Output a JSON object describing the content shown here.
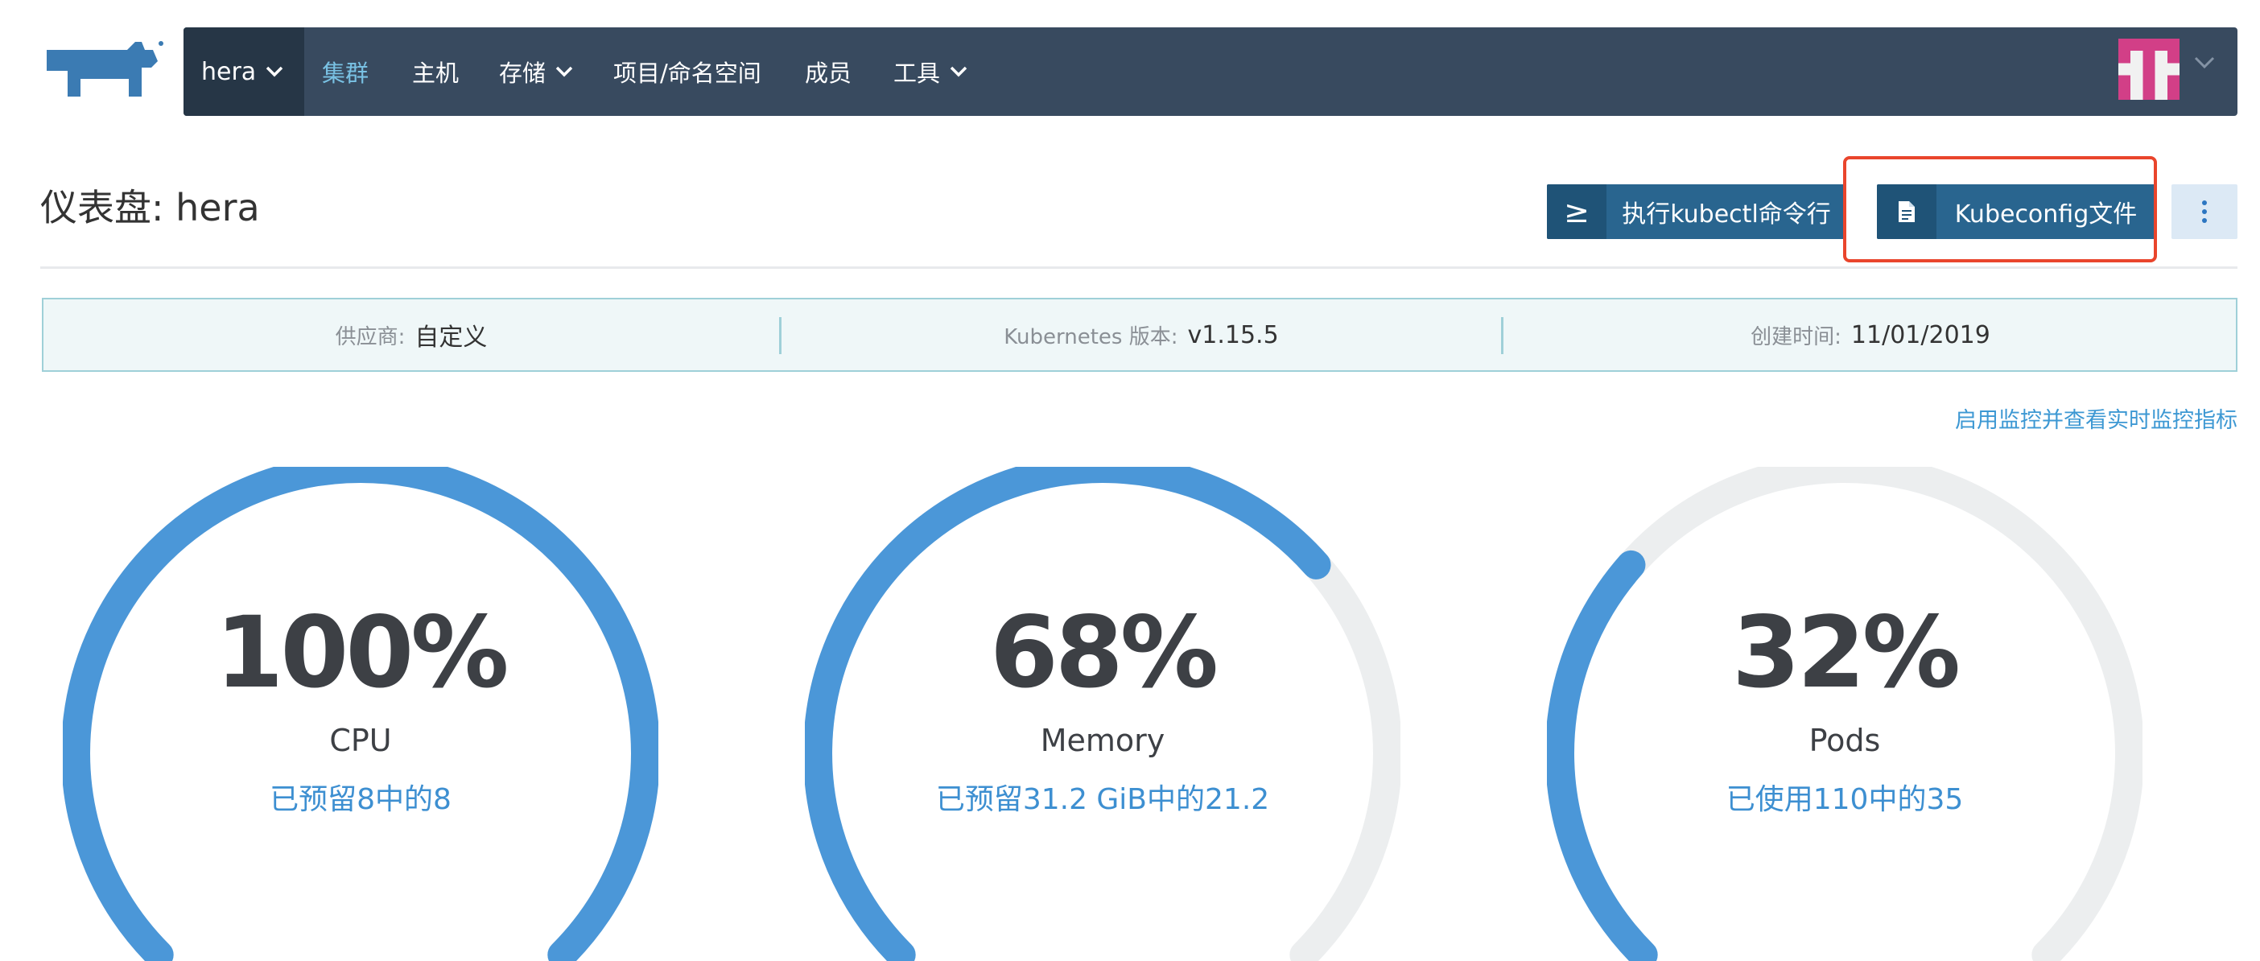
{
  "nav": {
    "cluster": "hera",
    "items": [
      {
        "label": "集群",
        "active": true,
        "dropdown": false
      },
      {
        "label": "主机",
        "active": false,
        "dropdown": false
      },
      {
        "label": "存储",
        "active": false,
        "dropdown": true
      },
      {
        "label": "项目/命名空间",
        "active": false,
        "dropdown": false
      },
      {
        "label": "成员",
        "active": false,
        "dropdown": false
      },
      {
        "label": "工具",
        "active": false,
        "dropdown": true
      }
    ]
  },
  "header": {
    "title": "仪表盘: hera",
    "kubectl_icon": "≥",
    "kubectl_label": "执行kubectl命令行",
    "kubeconfig_label": "Kubeconfig文件"
  },
  "info": {
    "provider_label": "供应商:",
    "provider_value": "自定义",
    "k8s_label": "Kubernetes 版本:",
    "k8s_value": "v1.15.5",
    "created_label": "创建时间:",
    "created_value": "11/01/2019"
  },
  "monitoring_link": "启用监控并查看实时监控指标",
  "gauges": [
    {
      "percent": "100%",
      "fraction": 1.0,
      "name": "CPU",
      "detail": "已预留8中的8"
    },
    {
      "percent": "68%",
      "fraction": 0.68,
      "name": "Memory",
      "detail": "已预留31.2 GiB中的21.2"
    },
    {
      "percent": "32%",
      "fraction": 0.32,
      "name": "Pods",
      "detail": "已使用110中的35"
    }
  ],
  "colors": {
    "nav_bg": "#384a5f",
    "nav_active": "#79c1e3",
    "button": "#29658f",
    "gauge_fill": "#4b97d8",
    "gauge_track": "#eceeef",
    "highlight": "#e9452c"
  }
}
